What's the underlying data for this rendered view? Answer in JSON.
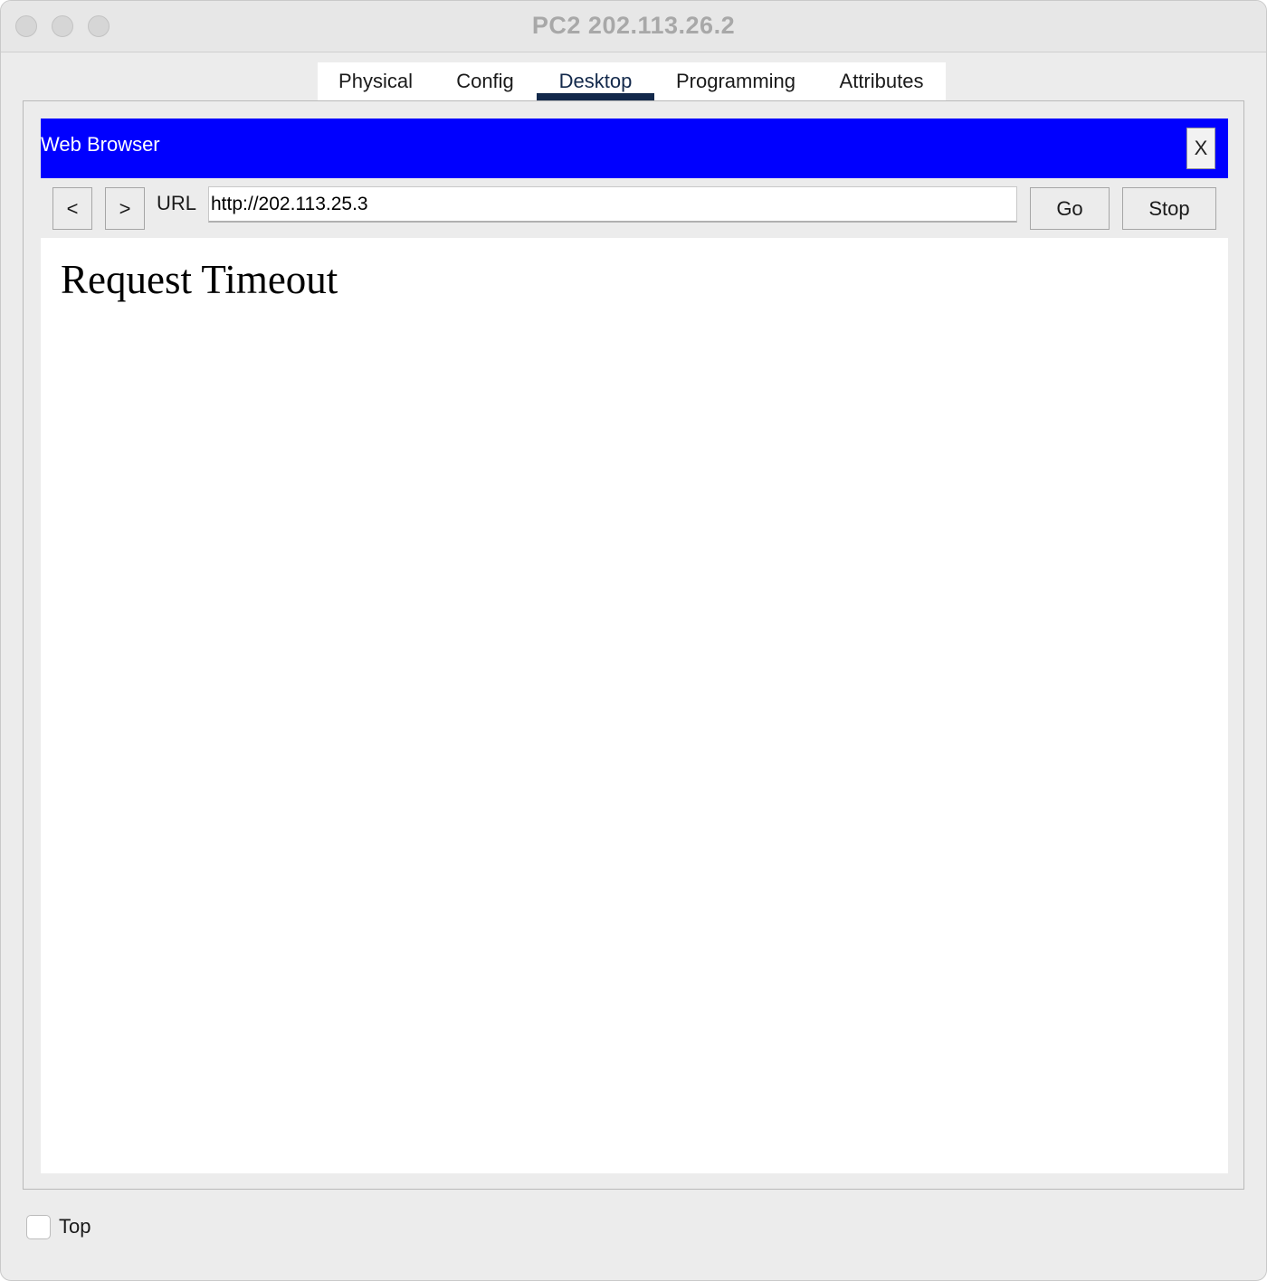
{
  "window": {
    "title": "PC2 202.113.26.2"
  },
  "tabs": [
    {
      "label": "Physical",
      "active": false
    },
    {
      "label": "Config",
      "active": false
    },
    {
      "label": "Desktop",
      "active": true
    },
    {
      "label": "Programming",
      "active": false
    },
    {
      "label": "Attributes",
      "active": false
    }
  ],
  "app": {
    "title": "Web Browser",
    "close_label": "X",
    "header_color": "#0000ff"
  },
  "toolbar": {
    "back_label": "<",
    "forward_label": ">",
    "url_label": "URL",
    "url_value": "http://202.113.25.3",
    "go_label": "Go",
    "stop_label": "Stop"
  },
  "page": {
    "heading": "Request Timeout"
  },
  "footer": {
    "top_label": "Top",
    "top_checked": false
  },
  "colors": {
    "active_tab": "#13294b"
  }
}
